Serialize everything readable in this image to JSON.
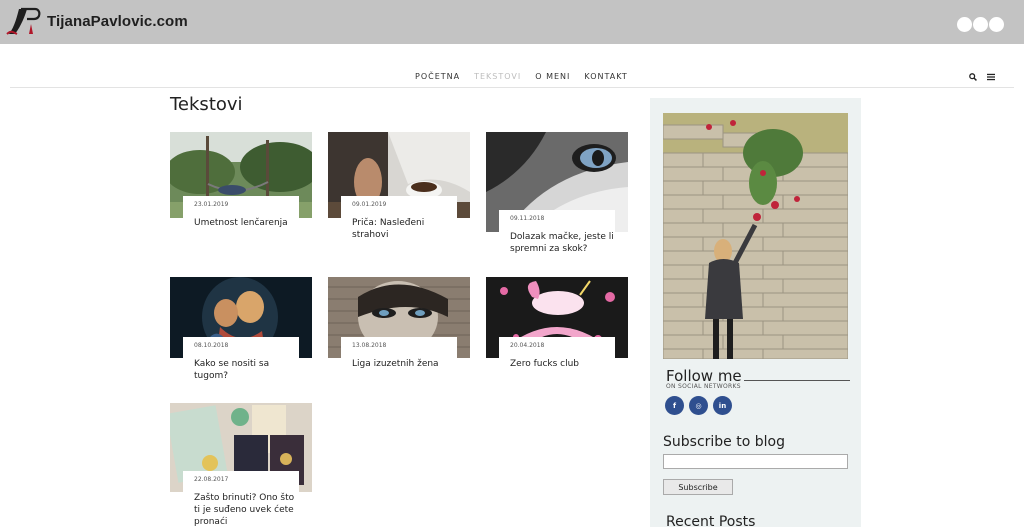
{
  "site": {
    "logo_text": "TijanaPavlovic.com"
  },
  "nav": {
    "items": [
      {
        "label": "POČETNA",
        "active": false
      },
      {
        "label": "TEKSTOVI",
        "active": true
      },
      {
        "label": "O MENI",
        "active": false
      },
      {
        "label": "KONTAKT",
        "active": false
      }
    ],
    "search_icon": "search-icon",
    "menu_icon": "hamburger-menu-icon"
  },
  "page": {
    "title": "Tekstovi"
  },
  "posts": [
    {
      "date": "23.01.2019",
      "title": "Umetnost lenčarenja"
    },
    {
      "date": "09.01.2019",
      "title": "Priča: Nasleđeni strahovi"
    },
    {
      "date": "09.11.2018",
      "title": "Dolazak mačke, jeste li spremni za skok?"
    },
    {
      "date": "08.10.2018",
      "title": "Kako se nositi sa tugom?"
    },
    {
      "date": "13.08.2018",
      "title": "Liga izuzetnih žena"
    },
    {
      "date": "20.04.2018",
      "title": "Zero fucks club"
    },
    {
      "date": "22.08.2017",
      "title": "Zašto brinuti? Ono što ti je suđeno uvek ćete pronaći"
    }
  ],
  "sidebar": {
    "follow_title": "Follow me",
    "follow_subtitle": "ON SOCIAL NETWORKS",
    "socials": [
      {
        "label": "f",
        "icon": "facebook-icon"
      },
      {
        "label": "◎",
        "icon": "instagram-icon"
      },
      {
        "label": "in",
        "icon": "linkedin-icon"
      }
    ],
    "subscribe_title": "Subscribe to blog",
    "subscribe_button": "Subscribe",
    "recent_title": "Recent Posts"
  },
  "colors": {
    "topbar": "#c3c3c3",
    "sidebar_bg": "#edf2f2",
    "social": "#2f4f8f",
    "nav_active": "#bdbdbd"
  }
}
